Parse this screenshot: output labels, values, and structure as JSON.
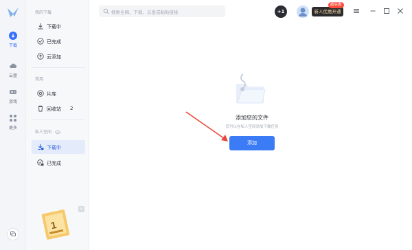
{
  "rail": {
    "items": [
      {
        "label": "下载",
        "icon": "download-icon"
      },
      {
        "label": "云盘",
        "icon": "cloud-icon"
      },
      {
        "label": "游戏",
        "icon": "gamepad-icon"
      },
      {
        "label": "更多",
        "icon": "grid-icon"
      }
    ]
  },
  "panel": {
    "my_downloads_title": "我的下载",
    "downloads": [
      {
        "label": "下载中",
        "icon": "download-icon"
      },
      {
        "label": "已完成",
        "icon": "check-circle-icon"
      },
      {
        "label": "云添加",
        "icon": "cloud-upload-icon"
      }
    ],
    "common_title": "常用",
    "common": [
      {
        "label": "片库",
        "icon": "film-icon"
      },
      {
        "label": "回收站",
        "icon": "trash-icon",
        "count": "2"
      }
    ],
    "private_title": "私人空间",
    "private": [
      {
        "label": "下载中",
        "icon": "private-download-icon"
      },
      {
        "label": "已完成",
        "icon": "private-check-icon"
      }
    ],
    "promo_close": "×"
  },
  "topbar": {
    "search_placeholder": "搜索全网、下载、云盘或粘贴链接",
    "plus_badge": "+1",
    "vip_label": "新人优惠开通",
    "vip_badge": "超实惠"
  },
  "empty": {
    "title": "添加您的文件",
    "subtitle": "您可以在私人空间添加下载任务",
    "add_button": "添加"
  },
  "colors": {
    "accent": "#3b7bf6",
    "arrow": "#e8473a"
  }
}
